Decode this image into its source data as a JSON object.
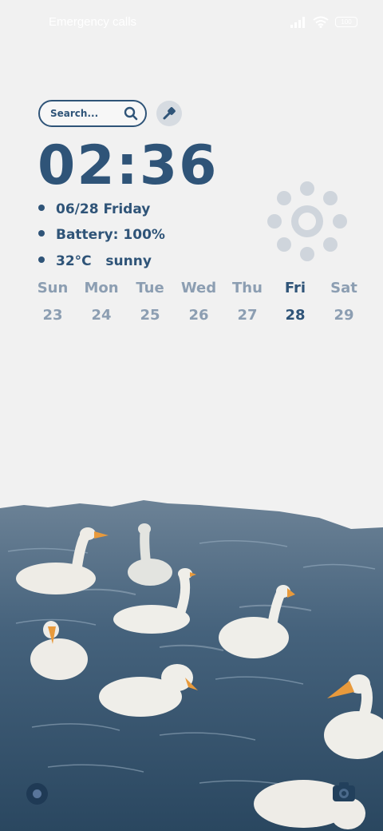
{
  "status_bar": {
    "carrier_text": "Emergency calls",
    "battery_level": "100",
    "signal_icon": "signal-bars-icon",
    "wifi_icon": "wifi-icon"
  },
  "search": {
    "placeholder": "Search..."
  },
  "clock": {
    "time": "02:36"
  },
  "info": {
    "date": "06/28 Friday",
    "battery_label": "Battery:",
    "battery_value": "100%",
    "temperature": "32°C",
    "condition": "sunny"
  },
  "week": [
    {
      "name": "Sun",
      "date": "23"
    },
    {
      "name": "Mon",
      "date": "24"
    },
    {
      "name": "Tue",
      "date": "25"
    },
    {
      "name": "Wed",
      "date": "26"
    },
    {
      "name": "Thu",
      "date": "27"
    },
    {
      "name": "Fri",
      "date": "28"
    },
    {
      "name": "Sat",
      "date": "29"
    }
  ],
  "colors": {
    "accent": "#2f5478",
    "muted": "#8c9eb2",
    "background": "#f1f1f1",
    "water": "#3d5a74"
  }
}
